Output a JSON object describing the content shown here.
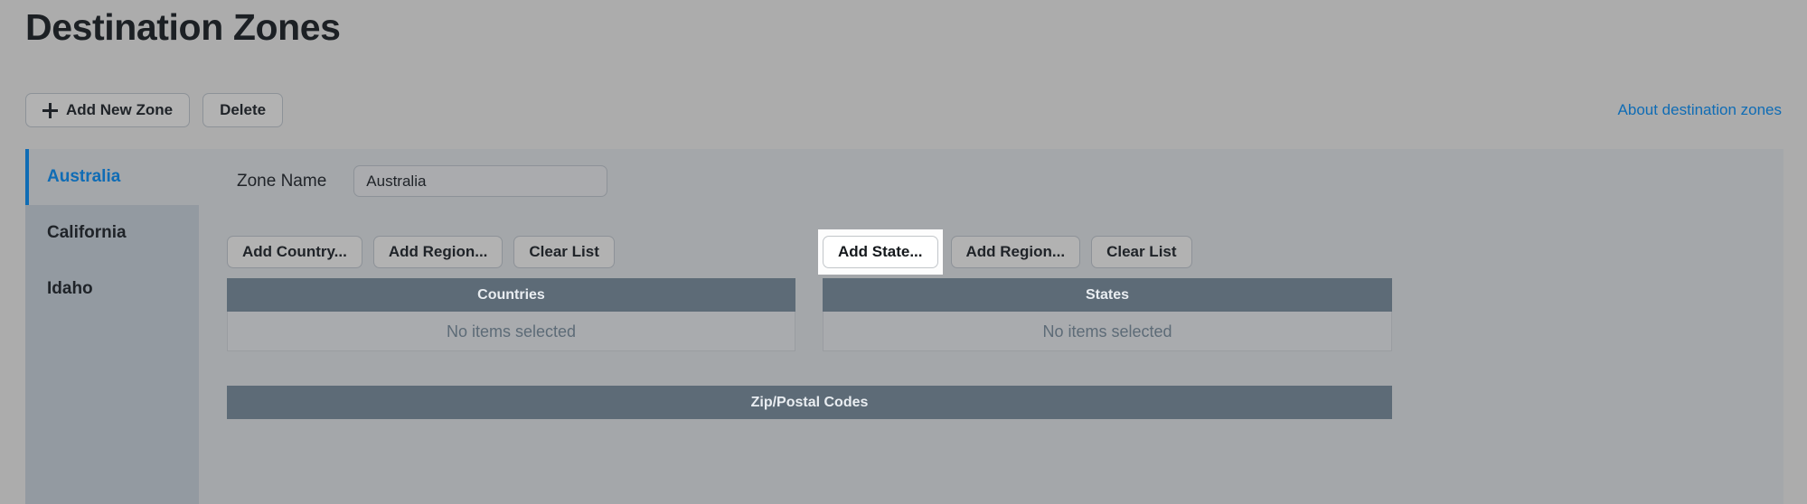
{
  "page": {
    "title": "Destination Zones"
  },
  "toolbar": {
    "add_zone_label": "Add New Zone",
    "delete_label": "Delete",
    "plus_icon": "plus-icon"
  },
  "help": {
    "link_label": "About destination zones",
    "link_color": "#0f6cb5"
  },
  "sidebar": {
    "items": [
      {
        "label": "Australia",
        "selected": true
      },
      {
        "label": "California",
        "selected": false
      },
      {
        "label": "Idaho",
        "selected": false
      }
    ]
  },
  "form": {
    "zone_name_label": "Zone Name",
    "zone_name_value": "Australia",
    "zone_name_placeholder": "Zone Name"
  },
  "countries_panel": {
    "add_button_label": "Add Country...",
    "add_region_label": "Add Region...",
    "clear_label": "Clear List",
    "table_header": "Countries",
    "empty_text": "No items selected"
  },
  "states_panel": {
    "add_button_label": "Add State...",
    "add_region_label": "Add Region...",
    "clear_label": "Clear List",
    "table_header": "States",
    "empty_text": "No items selected",
    "focused_button": "Add State..."
  },
  "zip_panel": {
    "table_header": "Zip/Postal Codes"
  },
  "colors": {
    "page_background": "#acacac",
    "panel_background": "#a4a7aa",
    "sidebar_background": "#939aa1",
    "table_header_background": "#5d6b77",
    "accent_blue": "#0f6cb5",
    "text_primary": "#1f2328"
  }
}
